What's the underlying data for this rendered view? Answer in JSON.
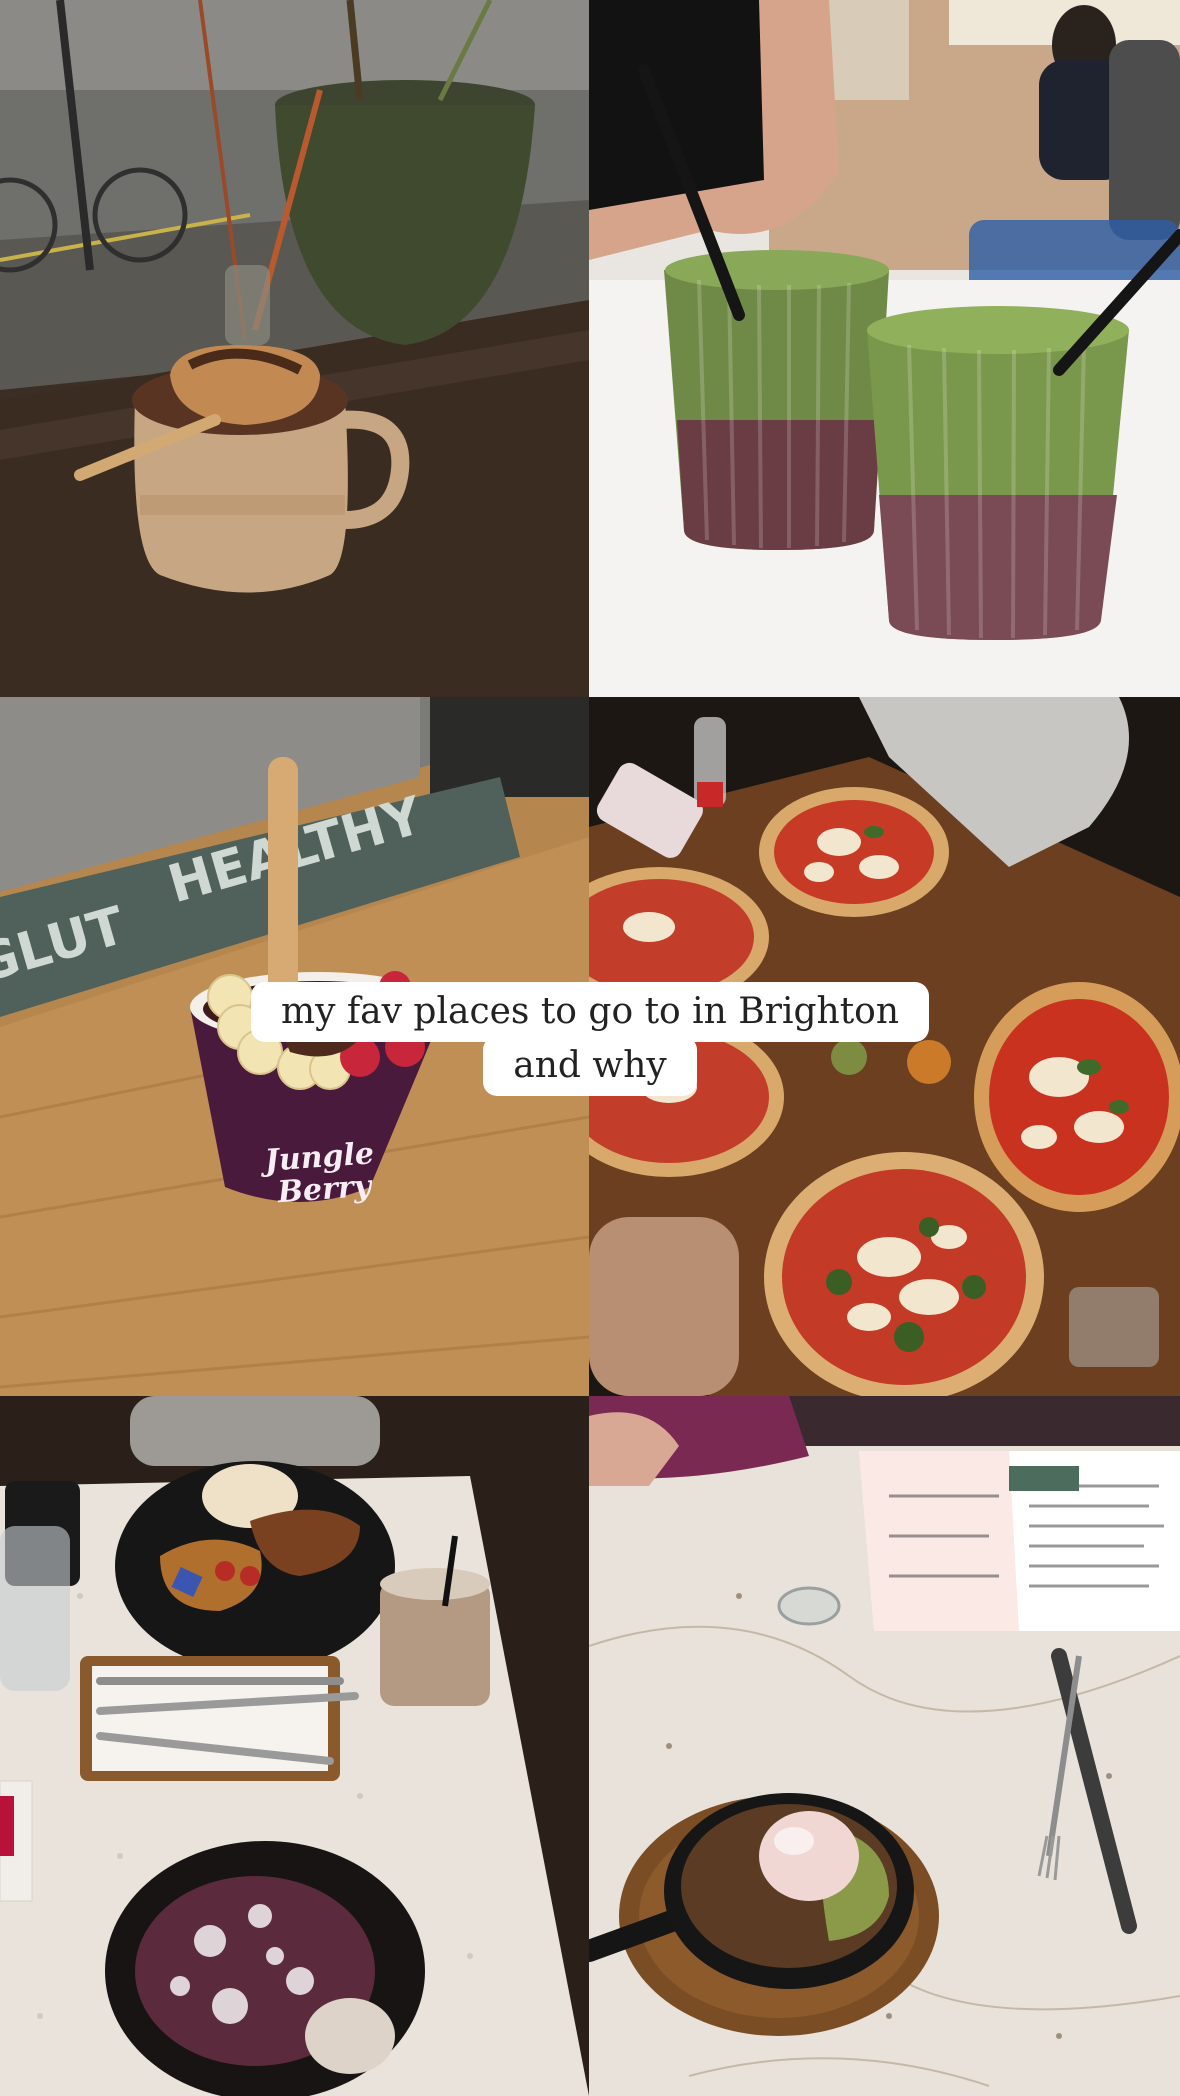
{
  "caption": {
    "line1": "my fav places to go to in Brighton",
    "line2": "and why"
  },
  "photos": [
    {
      "id": "hot-chocolate-marshmallow",
      "subject": "hot chocolate with toasted marshmallow"
    },
    {
      "id": "matcha-iced-drinks",
      "subject": "two layered iced matcha drinks"
    },
    {
      "id": "acai-bowl",
      "subject": "acai bowl with banana and strawberries"
    },
    {
      "id": "pizzas",
      "subject": "neapolitan pizzas on table"
    },
    {
      "id": "brunch-table",
      "subject": "french toast, iced coffee and pancakes"
    },
    {
      "id": "skillet-dessert",
      "subject": "chocolate skillet dessert with ice cream"
    }
  ],
  "signage": {
    "window_text": "HEALTHY",
    "window_text_2": "GLUT",
    "cup_brand_1": "Jungle",
    "cup_brand_2": "Berry"
  },
  "colors": {
    "caption_bg": "#ffffff",
    "caption_text": "#222222"
  }
}
